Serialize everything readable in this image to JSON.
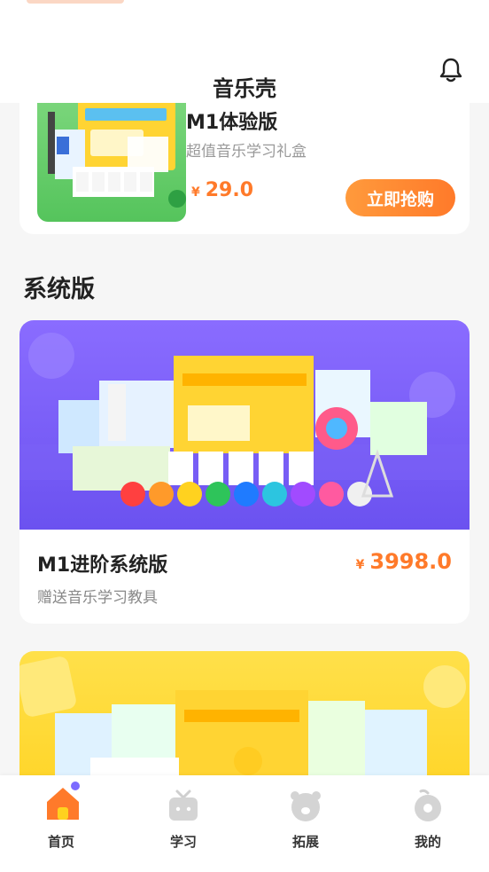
{
  "header": {
    "title": "音乐壳"
  },
  "trial_product": {
    "name": "M1体验版",
    "subtitle": "超值音乐学习礼盒",
    "currency": "¥",
    "price": "29.0",
    "button_label": "立即抢购"
  },
  "section": {
    "title": "系统版"
  },
  "system_product": {
    "name": "M1进阶系统版",
    "subtitle": "赠送音乐学习教具",
    "currency": "¥",
    "price": "3998.0"
  },
  "tabbar": {
    "items": [
      {
        "label": "首页",
        "icon": "home-icon",
        "active": true
      },
      {
        "label": "学习",
        "icon": "tv-icon",
        "active": false
      },
      {
        "label": "拓展",
        "icon": "bear-icon",
        "active": false
      },
      {
        "label": "我的",
        "icon": "profile-icon",
        "active": false
      }
    ]
  },
  "colors": {
    "accent": "#ff7a2a",
    "purple_banner": "#7a5ef5",
    "yellow_banner": "#ffd92e",
    "green_thumb": "#66cc66"
  }
}
